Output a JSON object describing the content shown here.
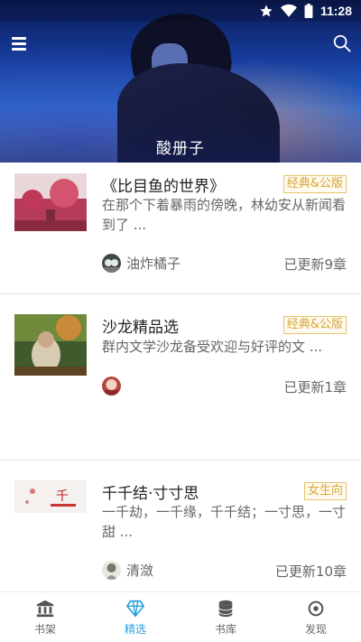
{
  "status_bar": {
    "time": "11:28",
    "icons": [
      "star-icon",
      "wifi-icon",
      "battery-icon"
    ]
  },
  "header": {
    "title": "酸册子",
    "menu_icon": "hamburger-icon",
    "search_icon": "search-icon"
  },
  "books": [
    {
      "title": "《比目鱼的世界》",
      "tag": "经典&公版",
      "description": "在那个下着暴雨的傍晚，林幼安从新闻看到了 ...",
      "author": "油炸橘子",
      "updates": "已更新9章"
    },
    {
      "title": "沙龙精品选",
      "tag": "经典&公版",
      "description": "群内文学沙龙备受欢迎与好评的文 ...",
      "author": "",
      "updates": "已更新1章"
    },
    {
      "title": "千千结·寸寸思",
      "tag": "女生向",
      "description": "一千劫，一千缘，千千结；一寸思，一寸甜 ...",
      "author": "清潋",
      "updates": "已更新10章"
    }
  ],
  "bottom_nav": [
    {
      "label": "书架",
      "icon": "bank-icon",
      "active": false
    },
    {
      "label": "精选",
      "icon": "diamond-icon",
      "active": true
    },
    {
      "label": "书库",
      "icon": "database-icon",
      "active": false
    },
    {
      "label": "发现",
      "icon": "target-icon",
      "active": false
    }
  ],
  "colors": {
    "accent": "#2aa1e0",
    "tag_text": "#d8a531",
    "tag_border": "#e6c46c"
  }
}
